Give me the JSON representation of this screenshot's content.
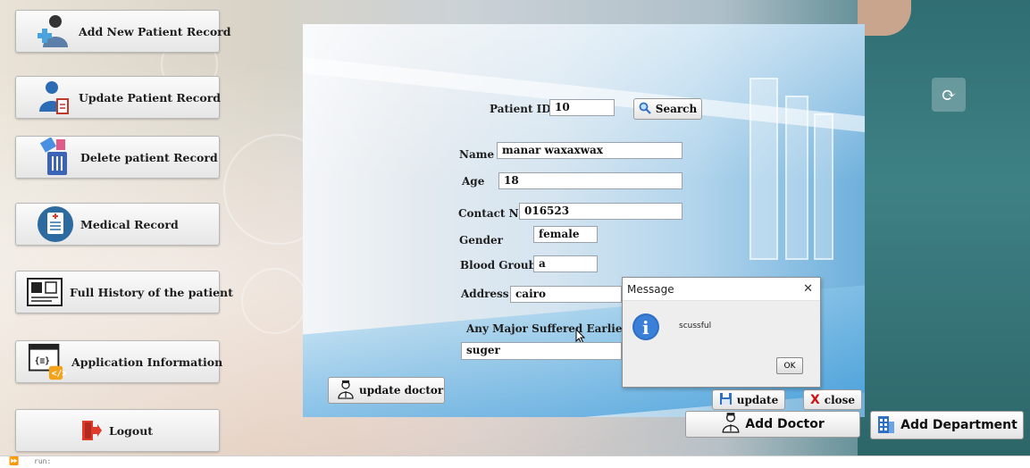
{
  "sidebar": {
    "items": [
      {
        "label": "Add New Patient Record"
      },
      {
        "label": "Update Patient Record"
      },
      {
        "label": "Delete patient Record"
      },
      {
        "label": "Medical Record"
      },
      {
        "label": "Full History of the patient"
      },
      {
        "label": "Application Information"
      },
      {
        "label": "Logout"
      }
    ]
  },
  "form": {
    "patient_id_label": "Patient ID",
    "patient_id_value": "10",
    "search_label": "Search",
    "name_label": "Name",
    "name_value": "manar waxaxwax",
    "age_label": "Age",
    "age_value": "18",
    "contact_label": "Contact NO",
    "contact_value": "016523",
    "gender_label": "Gender",
    "gender_value": "female",
    "blood_label": "Blood Groub",
    "blood_value": "a",
    "address_label": "Address",
    "address_value": "cairo",
    "disease_label": "Any Major Suffered Earlier",
    "disease_value": "suger",
    "update_doctor_label": "update doctor",
    "update_label": "update",
    "close_label": "close"
  },
  "dialog": {
    "title": "Message",
    "message": "scussful",
    "ok_label": "OK",
    "close_glyph": "✕"
  },
  "bottom": {
    "add_doctor_label": "Add Doctor",
    "add_department_label": "Add Department"
  },
  "statusbar": {
    "text": "run:"
  },
  "colors": {
    "info_blue": "#2f6fc4",
    "logout_red": "#e23a2a",
    "close_x": "#d01010"
  }
}
